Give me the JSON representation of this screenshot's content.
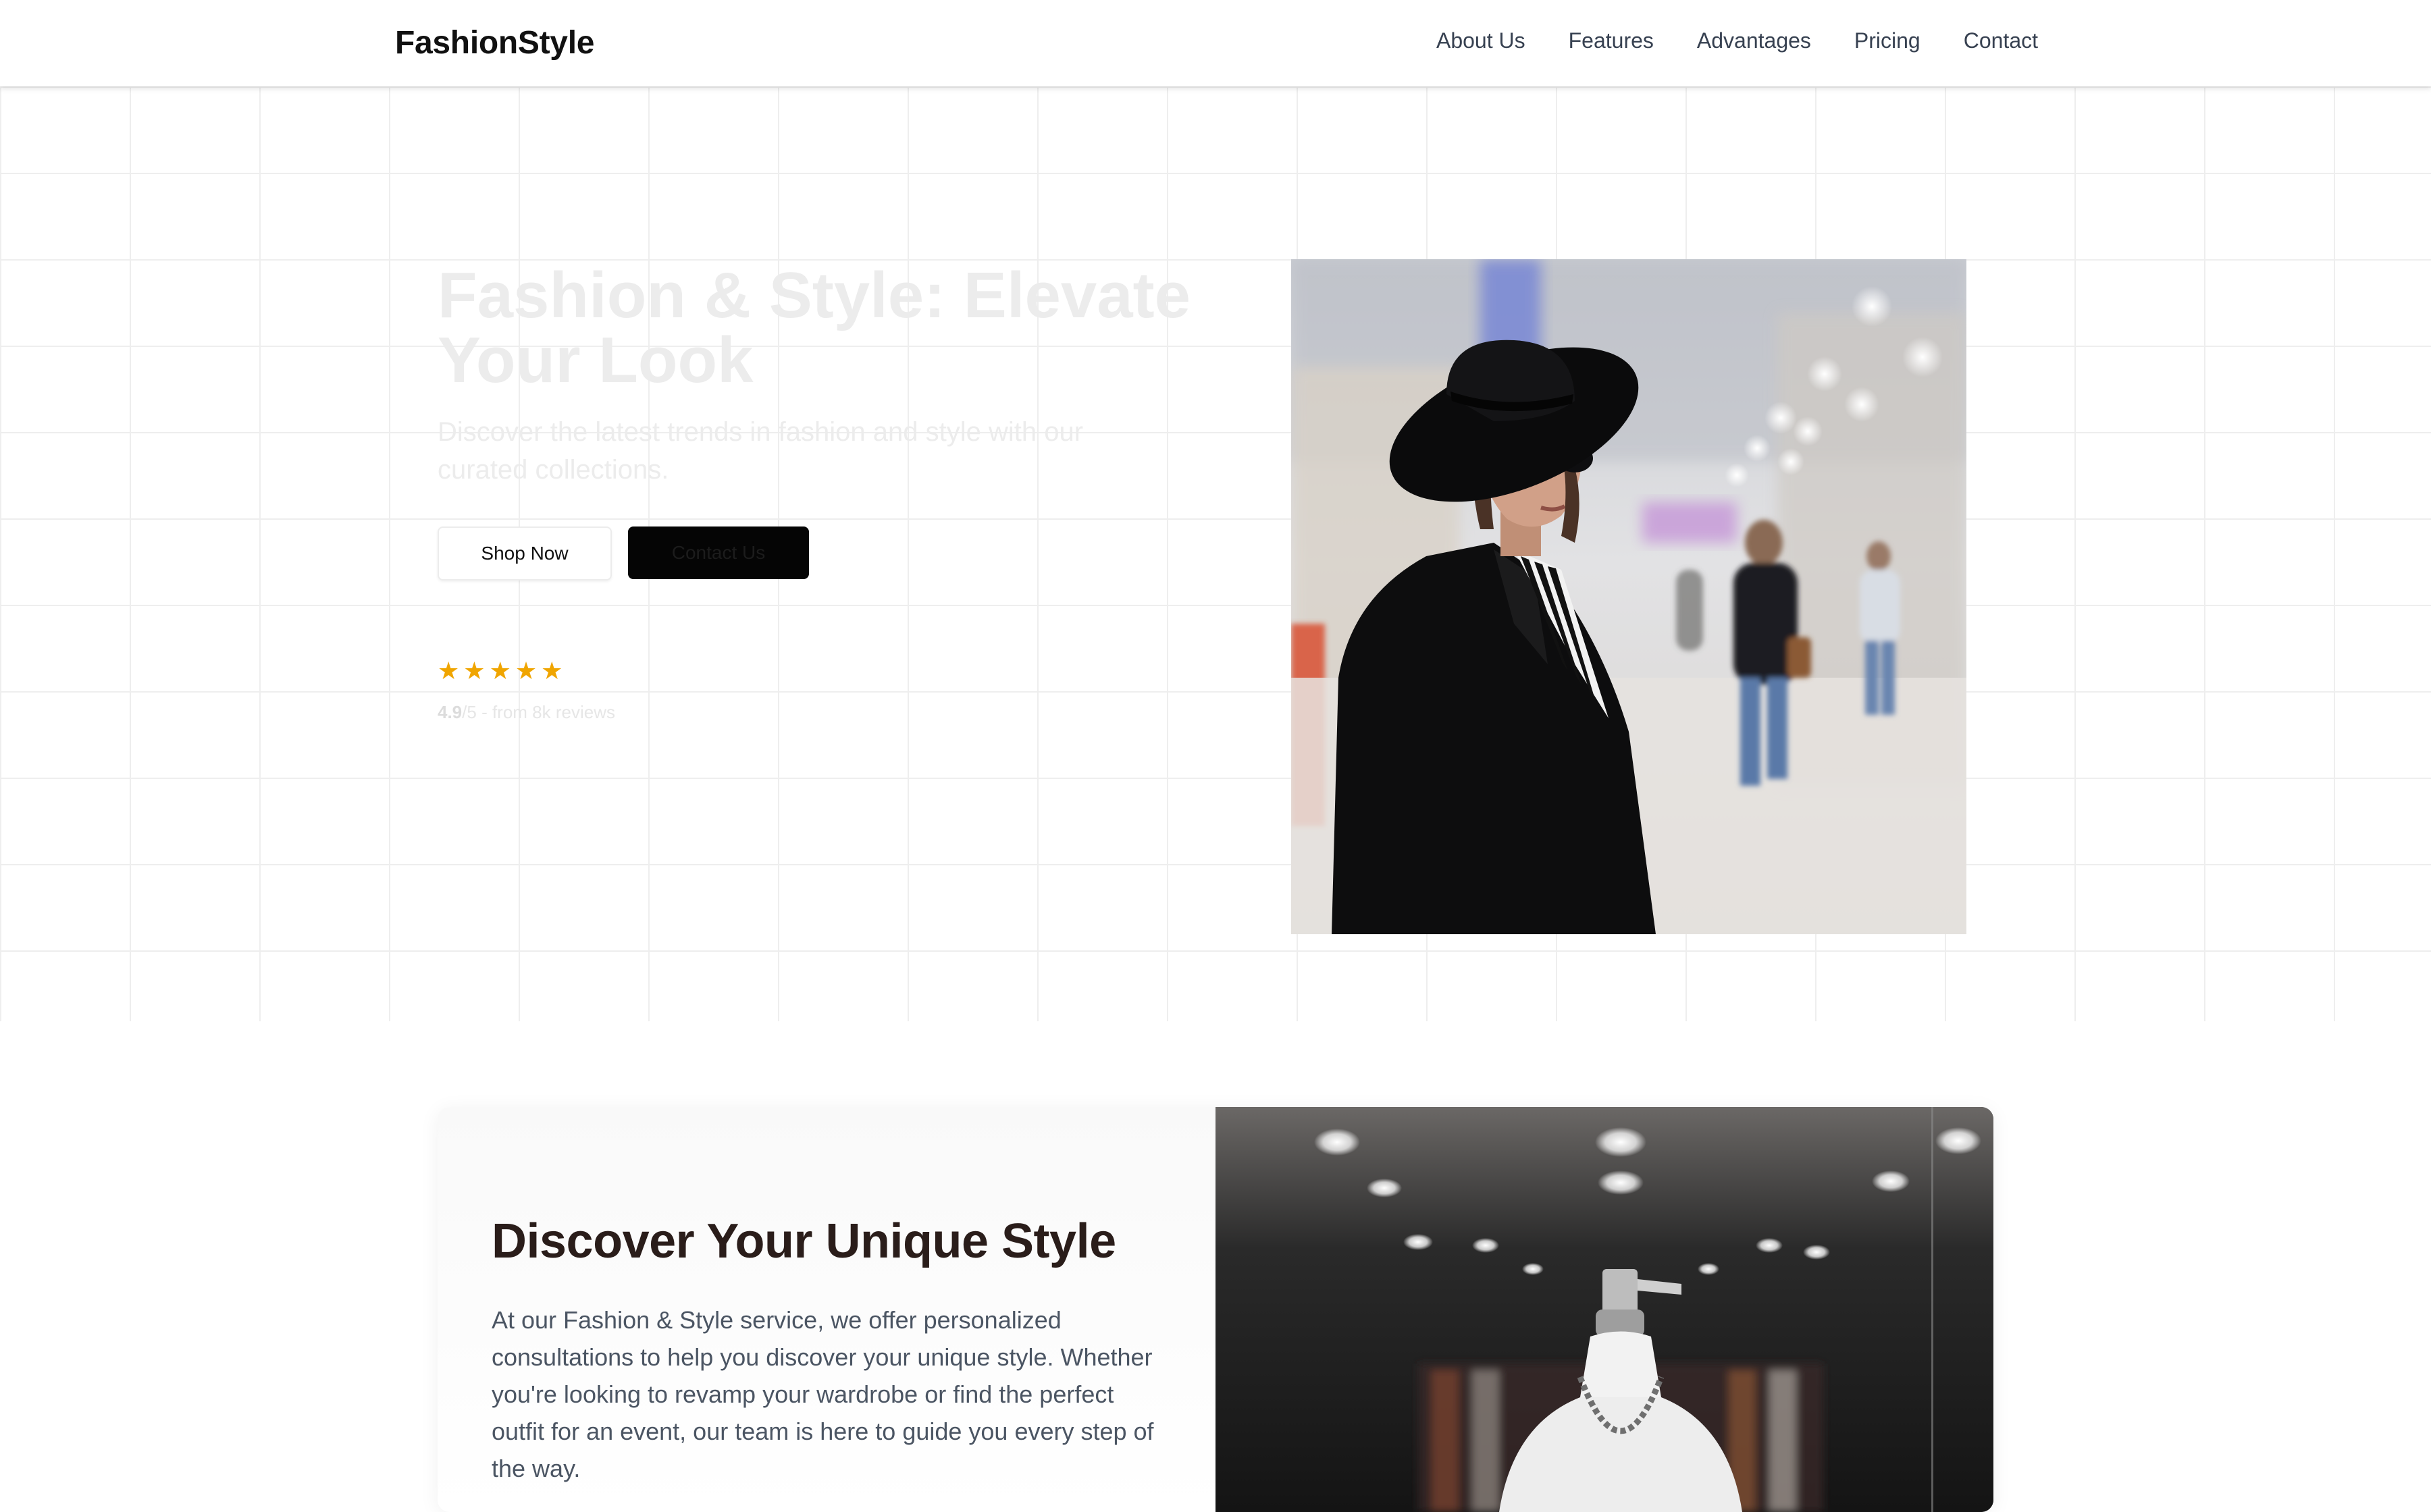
{
  "header": {
    "brand": "FashionStyle",
    "nav": [
      "About Us",
      "Features",
      "Advantages",
      "Pricing",
      "Contact"
    ]
  },
  "hero": {
    "title": "Fashion & Style: Elevate Your Look",
    "subtitle": "Discover the latest trends in fashion and style with our curated collections.",
    "primary_button": "Shop Now",
    "secondary_button": "Contact Us",
    "rating_value": "4.9",
    "rating_rest": "/5 - from 8k reviews",
    "stars": 5,
    "star_color": "#f0a500"
  },
  "discover": {
    "title": "Discover Your Unique Style",
    "body": "At our Fashion & Style service, we offer personalized consultations to help you discover your unique style. Whether you're looking to revamp your wardrobe or find the perfect outfit for an event, our team is here to guide you every step of the way."
  },
  "colors": {
    "accent_dark": "#050505",
    "heading": "#2a1d1a",
    "body_text": "#4b5563"
  }
}
